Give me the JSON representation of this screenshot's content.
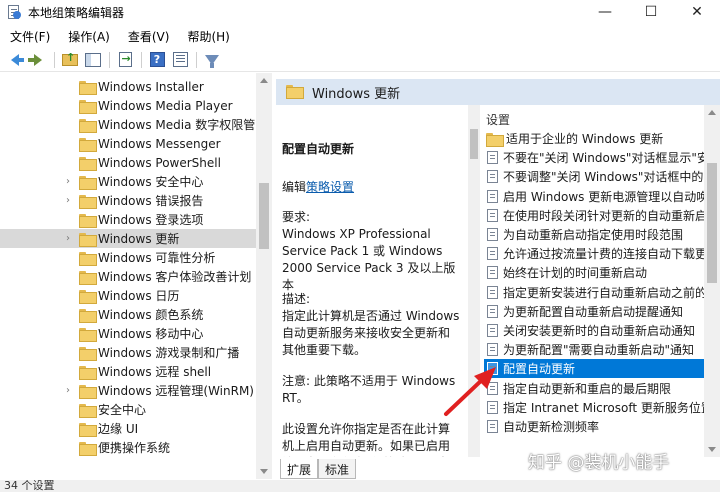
{
  "window": {
    "title": "本地组策略编辑器",
    "controls": [
      "—",
      "☐",
      "✕"
    ]
  },
  "menu": [
    "文件(F)",
    "操作(A)",
    "查看(V)",
    "帮助(H)"
  ],
  "tree": {
    "items": [
      {
        "label": "Windows Installer",
        "expandable": false
      },
      {
        "label": "Windows Media Player",
        "expandable": false
      },
      {
        "label": "Windows Media 数字权限管",
        "expandable": false
      },
      {
        "label": "Windows Messenger",
        "expandable": false
      },
      {
        "label": "Windows PowerShell",
        "expandable": false
      },
      {
        "label": "Windows 安全中心",
        "expandable": true
      },
      {
        "label": "Windows 错误报告",
        "expandable": true
      },
      {
        "label": "Windows 登录选项",
        "expandable": false
      },
      {
        "label": "Windows 更新",
        "expandable": true,
        "selected": true
      },
      {
        "label": "Windows 可靠性分析",
        "expandable": false
      },
      {
        "label": "Windows 客户体验改善计划",
        "expandable": false
      },
      {
        "label": "Windows 日历",
        "expandable": false
      },
      {
        "label": "Windows 颜色系统",
        "expandable": false
      },
      {
        "label": "Windows 移动中心",
        "expandable": false
      },
      {
        "label": "Windows 游戏录制和广播",
        "expandable": false
      },
      {
        "label": "Windows 远程 shell",
        "expandable": false
      },
      {
        "label": "Windows 远程管理(WinRM)",
        "expandable": true
      },
      {
        "label": "安全中心",
        "expandable": false
      },
      {
        "label": "边缘 UI",
        "expandable": false
      },
      {
        "label": "便携操作系统",
        "expandable": false
      }
    ]
  },
  "right": {
    "header": "Windows 更新",
    "description": {
      "title": "配置自动更新",
      "edit_prefix": "编辑",
      "edit_link": "策略设置",
      "requirements": "要求:\nWindows XP Professional Service Pack 1 或 Windows 2000 Service Pack 3 及以上版本",
      "desc": "描述:\n指定此计算机是否通过 Windows 自动更新服务来接收安全更新和其他重要下载。",
      "note": "注意: 此策略不适用于 Windows RT。",
      "more": "此设置允许你指定是否在此计算机上启用自动更新。如果已启用该服务，必须在\"组策略设置\"中的四个选项中选择一个:"
    },
    "settings_header": "设置",
    "settings": [
      {
        "label": "适用于企业的 Windows 更新",
        "type": "folder"
      },
      {
        "label": "不要在\"关闭 Windows\"对话框显示\"安装",
        "type": "policy"
      },
      {
        "label": "不要调整\"关闭 Windows\"对话框中的\"安",
        "type": "policy"
      },
      {
        "label": "启用 Windows 更新电源管理以自动唤醒",
        "type": "policy"
      },
      {
        "label": "在使用时段关闭针对更新的自动重新启动",
        "type": "policy"
      },
      {
        "label": "为自动重新启动指定使用时段范围",
        "type": "policy"
      },
      {
        "label": "允许通过按流量计费的连接自动下载更新",
        "type": "policy"
      },
      {
        "label": "始终在计划的时间重新启动",
        "type": "policy"
      },
      {
        "label": "指定更新安装进行自动重新启动之前的期",
        "type": "policy"
      },
      {
        "label": "为更新配置自动重新启动提醒通知",
        "type": "policy"
      },
      {
        "label": "关闭安装更新时的自动重新启动通知",
        "type": "policy"
      },
      {
        "label": "为更新配置\"需要自动重新启动\"通知",
        "type": "policy"
      },
      {
        "label": "配置自动更新",
        "type": "policy",
        "selected": true
      },
      {
        "label": "指定自动更新和重启的最后期限",
        "type": "policy"
      },
      {
        "label": "指定 Intranet Microsoft 更新服务位置",
        "type": "policy"
      },
      {
        "label": "自动更新检测频率",
        "type": "policy"
      }
    ],
    "tabs": [
      "扩展",
      "标准"
    ]
  },
  "status": "34 个设置",
  "watermark": "知乎 @装机小能手",
  "colors": {
    "selection": "#0078d7",
    "header_bg": "#dbe6f3",
    "annotation_arrow": "#e02020"
  }
}
